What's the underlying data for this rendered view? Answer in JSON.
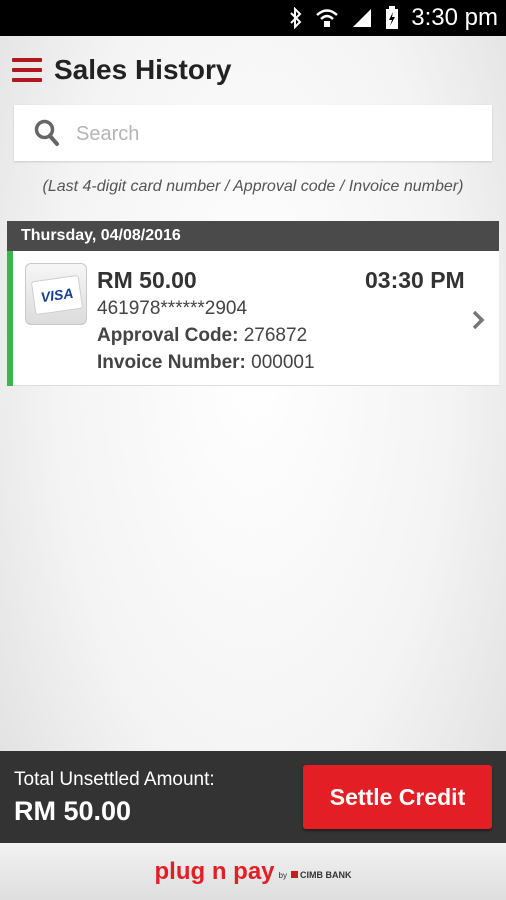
{
  "status_bar": {
    "time": "3:30 pm"
  },
  "header": {
    "title": "Sales History"
  },
  "search": {
    "placeholder": "Search",
    "hint": "(Last 4-digit card number / Approval code / Invoice number)"
  },
  "history": {
    "date_label": "Thursday, 04/08/2016",
    "transactions": [
      {
        "card_brand": "VISA",
        "amount": "RM 50.00",
        "time": "03:30 PM",
        "card_number": "461978******2904",
        "approval_label": "Approval Code:",
        "approval_code": "276872",
        "invoice_label": "Invoice Number:",
        "invoice_number": "000001",
        "status_color": "#3cb54a"
      }
    ]
  },
  "summary": {
    "total_label": "Total Unsettled Amount:",
    "total_value": "RM 50.00",
    "settle_label": "Settle Credit"
  },
  "footer": {
    "brand": "plug n pay",
    "by": "by",
    "bank": "CIMB BANK"
  },
  "colors": {
    "accent": "#e31e24",
    "menu": "#b3161d",
    "success": "#3cb54a",
    "bar": "#333333"
  }
}
